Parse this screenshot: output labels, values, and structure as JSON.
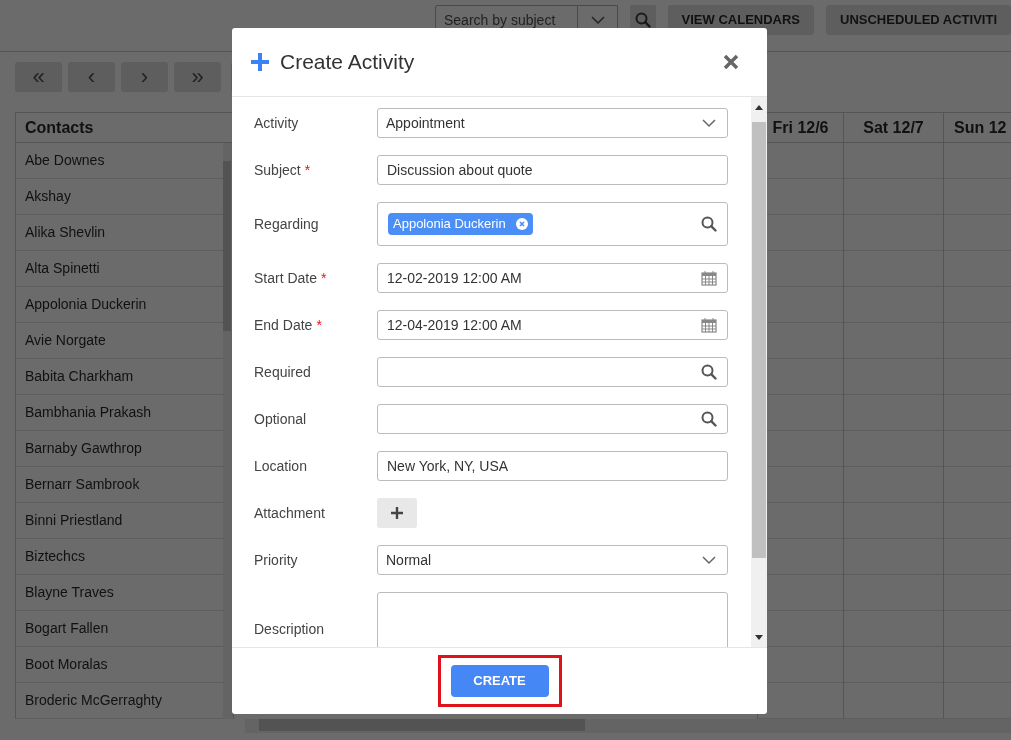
{
  "toolbar": {
    "search": {
      "placeholder": "Search by subject"
    },
    "buttons": [
      "VIEW CALENDARS",
      "UNSCHEDULED ACTIVITI"
    ]
  },
  "nav_buttons": [
    "«",
    "‹",
    "›",
    "»"
  ],
  "grid": {
    "contacts_header": "Contacts",
    "day_columns": [
      "Fri 12/6",
      "Sat 12/7",
      "Sun 12"
    ],
    "contacts": [
      "Abe Downes",
      "Akshay",
      "Alika Shevlin",
      "Alta Spinetti",
      "Appolonia Duckerin",
      "Avie Norgate",
      "Babita Charkham",
      "Bambhania Prakash",
      "Barnaby Gawthrop",
      "Bernarr Sambrook",
      "Binni Priestland",
      "Biztechcs",
      "Blayne Traves",
      "Bogart Fallen",
      "Boot Moralas",
      "Broderic McGerraghty"
    ]
  },
  "dialog": {
    "title": "Create Activity",
    "fields": [
      {
        "kind": "select",
        "label": "Activity",
        "value": "Appointment"
      },
      {
        "kind": "text",
        "label": "Subject",
        "required_mark": "*",
        "value": "Discussion about quote"
      },
      {
        "kind": "lookup",
        "label": "Regarding",
        "chips": [
          "Appolonia Duckerin"
        ]
      },
      {
        "kind": "date",
        "label": "Start Date",
        "required_mark": "*",
        "value": "12-02-2019 12:00 AM"
      },
      {
        "kind": "date",
        "label": "End Date",
        "required_mark": "*",
        "value": "12-04-2019 12:00 AM"
      },
      {
        "kind": "lookup",
        "label": "Required"
      },
      {
        "kind": "lookup",
        "label": "Optional"
      },
      {
        "kind": "text",
        "label": "Location",
        "value": "New York, NY, USA"
      },
      {
        "kind": "attachment",
        "label": "Attachment"
      },
      {
        "kind": "select",
        "label": "Priority",
        "value": "Normal"
      },
      {
        "kind": "textarea",
        "label": "Description"
      }
    ],
    "create_button": "CREATE",
    "create_highlighted": true
  }
}
